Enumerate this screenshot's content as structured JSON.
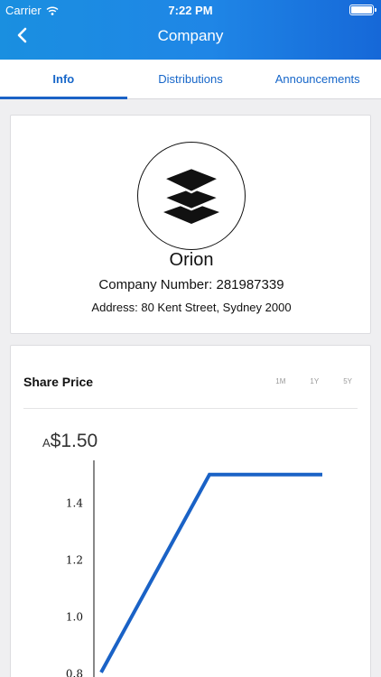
{
  "status": {
    "carrier": "Carrier",
    "time": "7:22 PM"
  },
  "nav": {
    "title": "Company"
  },
  "tabs": [
    "Info",
    "Distributions",
    "Announcements"
  ],
  "company": {
    "name": "Orion",
    "number_label": "Company Number: 281987339",
    "address": "Address: 80 Kent Street, Sydney 2000"
  },
  "share": {
    "title": "Share Price",
    "ranges": [
      "1M",
      "1Y",
      "5Y"
    ],
    "currency_prefix": "A",
    "price": "$1.50"
  },
  "colors": {
    "accent": "#1a62c6",
    "header_start": "#1a8fe0",
    "header_end": "#1668d8"
  },
  "chart_data": {
    "type": "line",
    "x": [
      0,
      1,
      2
    ],
    "values": [
      0.7,
      1.5,
      1.5
    ],
    "y_ticks": [
      "1.4",
      "1.2",
      "1.0",
      "0.8"
    ],
    "ylim": [
      0.75,
      1.55
    ],
    "grid": false
  }
}
